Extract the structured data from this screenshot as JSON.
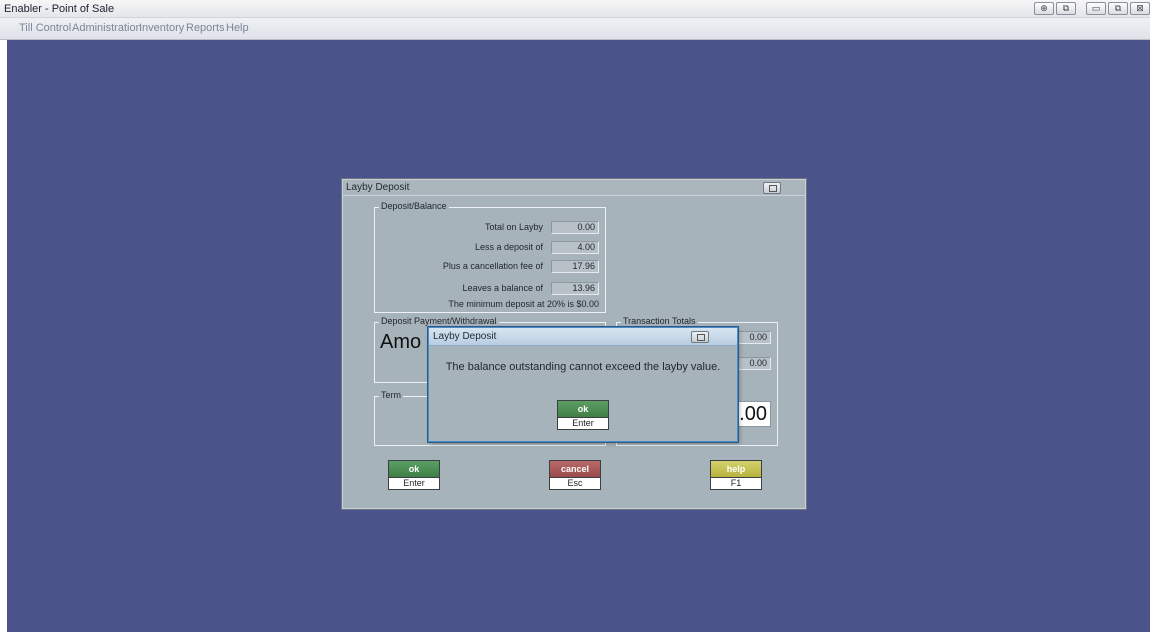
{
  "app": {
    "title": "Enabler - Point of Sale",
    "window_controls": [
      "⊕",
      "⧉",
      "▭",
      "⧉",
      "⊠"
    ]
  },
  "menu": {
    "items": [
      "Till Control",
      "Administration",
      "Inventory",
      "Reports",
      "Help"
    ]
  },
  "layby_dialog": {
    "title": "Layby Deposit",
    "deposit_balance": {
      "legend": "Deposit/Balance",
      "rows": [
        {
          "label": "Total on Layby",
          "value": "0.00"
        },
        {
          "label": "Less a deposit of",
          "value": "4.00"
        },
        {
          "label": "Plus a cancellation fee of",
          "value": "17.96"
        },
        {
          "label": "Leaves a balance of",
          "value": "13.96"
        }
      ],
      "minimum_note": "The minimum deposit at 20% is $0.00"
    },
    "deposit_payment": {
      "legend": "Deposit Payment/Withdrawal",
      "amount_partial": "Amo"
    },
    "transaction_totals": {
      "legend": "Transaction Totals",
      "values": [
        "0.00",
        "0.00"
      ],
      "big_total": "0.00"
    },
    "term": {
      "legend": "Term"
    },
    "buttons": {
      "ok": {
        "label": "ok",
        "key": "Enter"
      },
      "cancel": {
        "label": "cancel",
        "key": "Esc"
      },
      "help": {
        "label": "help",
        "key": "F1"
      }
    }
  },
  "message_box": {
    "title": "Layby Deposit",
    "message": "The balance outstanding cannot exceed the layby value.",
    "ok": {
      "label": "ok",
      "key": "Enter"
    }
  },
  "colors": {
    "desktop": "#4a548a",
    "dialog_bg": "#a7b3ba",
    "ok_green": "#3f7f47",
    "cancel_red": "#9a4a4a",
    "help_yellow": "#b8b43d"
  }
}
